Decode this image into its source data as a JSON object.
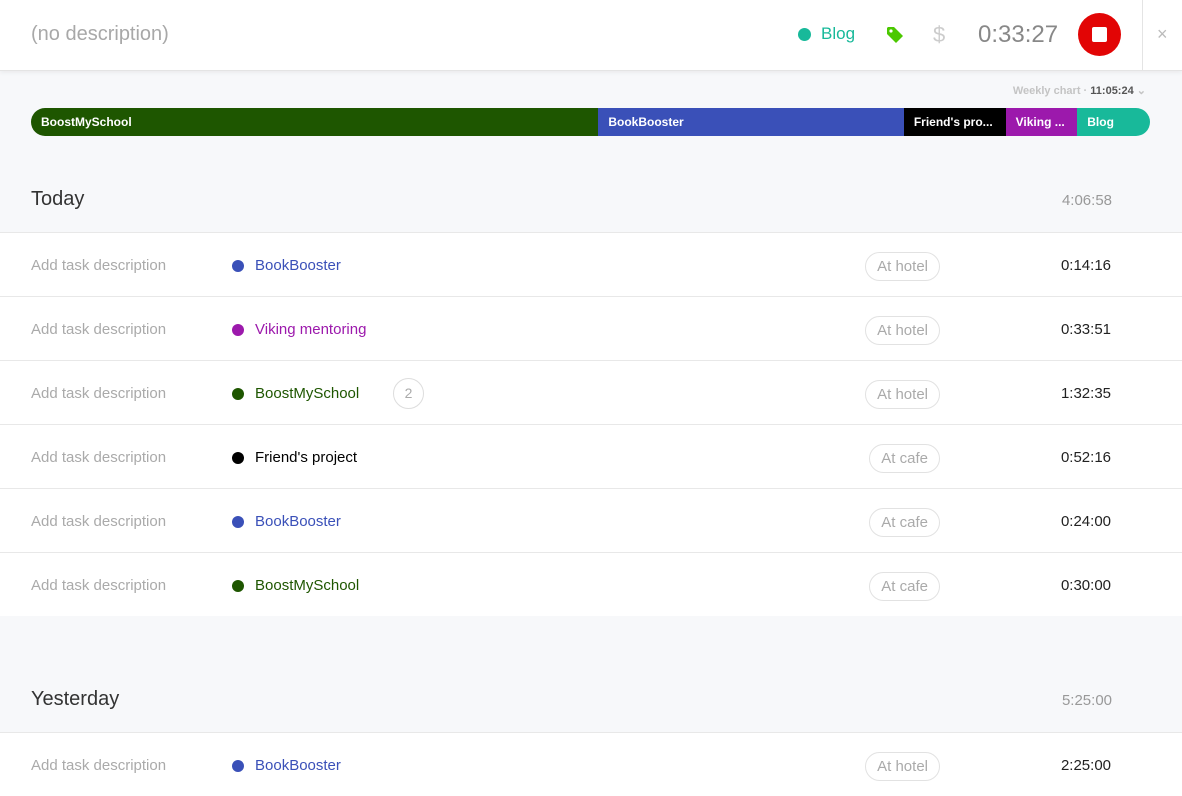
{
  "header": {
    "description_placeholder": "(no description)",
    "project": "Blog",
    "project_color": "#18b99a",
    "timer": "0:33:27",
    "close": "×"
  },
  "weekly": {
    "label": "Weekly chart",
    "total": "11:05:24"
  },
  "bar": [
    {
      "name": "BoostMySchool",
      "color": "#1e5600",
      "share": 0.507
    },
    {
      "name": "BookBooster",
      "color": "#3a50b8",
      "share": 0.273
    },
    {
      "name": "Friend's pro...",
      "color": "#000000",
      "share": 0.091
    },
    {
      "name": "Viking ...",
      "color": "#9c19ac",
      "share": 0.064
    },
    {
      "name": "Blog",
      "color": "#18b99a",
      "share": 0.065
    }
  ],
  "sections": [
    {
      "title": "Today",
      "total": "4:06:58",
      "entries": [
        {
          "desc": "Add task description",
          "project": "BookBooster",
          "color": "#3a50b8",
          "tag": "At hotel",
          "duration": "0:14:16"
        },
        {
          "desc": "Add task description",
          "project": "Viking mentoring",
          "color": "#9c19ac",
          "tag": "At hotel",
          "duration": "0:33:51"
        },
        {
          "desc": "Add task description",
          "project": "BoostMySchool",
          "color": "#1e5600",
          "count": "2",
          "tag": "At hotel",
          "duration": "1:32:35"
        },
        {
          "desc": "Add task description",
          "project": "Friend's project",
          "color": "#000000",
          "tag": "At cafe",
          "duration": "0:52:16"
        },
        {
          "desc": "Add task description",
          "project": "BookBooster",
          "color": "#3a50b8",
          "tag": "At cafe",
          "duration": "0:24:00"
        },
        {
          "desc": "Add task description",
          "project": "BoostMySchool",
          "color": "#1e5600",
          "tag": "At cafe",
          "duration": "0:30:00"
        }
      ]
    },
    {
      "title": "Yesterday",
      "total": "5:25:00",
      "entries": [
        {
          "desc": "Add task description",
          "project": "BookBooster",
          "color": "#3a50b8",
          "tag": "At hotel",
          "duration": "2:25:00"
        }
      ]
    }
  ]
}
